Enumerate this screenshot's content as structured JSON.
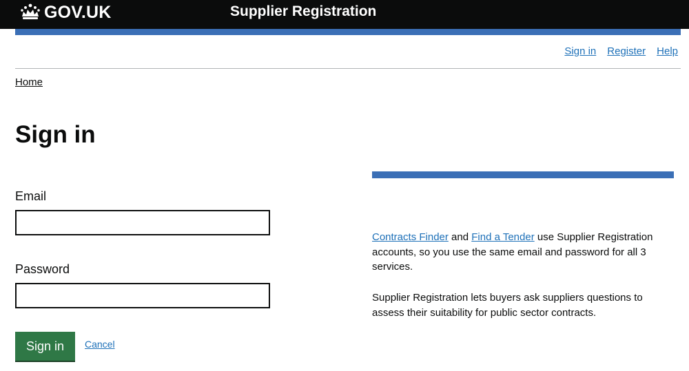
{
  "header": {
    "logo_text": "GOV.UK",
    "service_name": "Supplier Registration"
  },
  "nav": {
    "items": [
      {
        "label": "Sign in"
      },
      {
        "label": "Register"
      },
      {
        "label": "Help"
      }
    ]
  },
  "breadcrumb": {
    "home": "Home"
  },
  "page": {
    "title": "Sign in"
  },
  "form": {
    "email_label": "Email",
    "email_value": "",
    "password_label": "Password",
    "password_value": "",
    "submit_label": "Sign in",
    "cancel_label": "Cancel"
  },
  "sidebar": {
    "link1": "Contracts Finder",
    "text1": " and ",
    "link2": "Find a Tender",
    "text2": " use Supplier Registration accounts, so you use the same email and password for all 3 services.",
    "para2": "Supplier Registration lets buyers ask suppliers questions to assess their suitability for public sector contracts."
  },
  "colors": {
    "header_bg": "#0b0c0c",
    "accent_blue": "#3b6fb6",
    "link": "#1d70b8",
    "button_green": "#2f7846"
  }
}
